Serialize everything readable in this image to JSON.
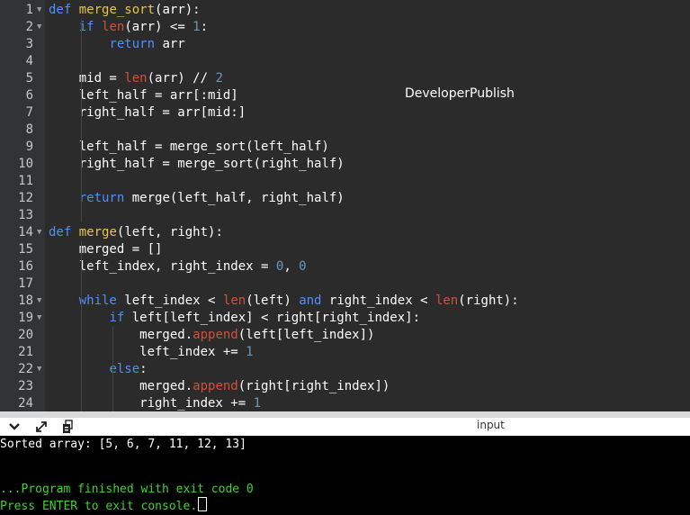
{
  "editor": {
    "watermark": "DeveloperPublish",
    "lines": [
      {
        "n": "1",
        "fold": true,
        "tokens": [
          [
            "def",
            "kw"
          ],
          [
            " "
          ],
          [
            "merge_sort",
            "fn"
          ],
          [
            "(arr):"
          ]
        ]
      },
      {
        "n": "2",
        "fold": true,
        "tokens": [
          [
            "    "
          ],
          [
            "if",
            "kw"
          ],
          [
            " "
          ],
          [
            "len",
            "bi"
          ],
          [
            "(arr) <= "
          ],
          [
            "1",
            "num"
          ],
          [
            ":"
          ]
        ]
      },
      {
        "n": "3",
        "tokens": [
          [
            "        "
          ],
          [
            "return",
            "kw"
          ],
          [
            " arr"
          ]
        ]
      },
      {
        "n": "4",
        "tokens": []
      },
      {
        "n": "5",
        "tokens": [
          [
            "    mid = "
          ],
          [
            "len",
            "bi"
          ],
          [
            "(arr) // "
          ],
          [
            "2",
            "num"
          ]
        ]
      },
      {
        "n": "6",
        "tokens": [
          [
            "    left_half = arr[:mid]"
          ]
        ]
      },
      {
        "n": "7",
        "tokens": [
          [
            "    right_half = arr[mid:]"
          ]
        ]
      },
      {
        "n": "8",
        "tokens": []
      },
      {
        "n": "9",
        "tokens": [
          [
            "    left_half = merge_sort(left_half)"
          ]
        ]
      },
      {
        "n": "10",
        "tokens": [
          [
            "    right_half = merge_sort(right_half)"
          ]
        ]
      },
      {
        "n": "11",
        "tokens": []
      },
      {
        "n": "12",
        "tokens": [
          [
            "    "
          ],
          [
            "return",
            "kw"
          ],
          [
            " merge(left_half, right_half)"
          ]
        ]
      },
      {
        "n": "13",
        "tokens": []
      },
      {
        "n": "14",
        "fold": true,
        "tokens": [
          [
            "def",
            "kw"
          ],
          [
            " "
          ],
          [
            "merge",
            "fn"
          ],
          [
            "(left, right):"
          ]
        ]
      },
      {
        "n": "15",
        "tokens": [
          [
            "    merged = []"
          ]
        ]
      },
      {
        "n": "16",
        "tokens": [
          [
            "    left_index, right_index = "
          ],
          [
            "0",
            "num"
          ],
          [
            ", "
          ],
          [
            "0",
            "num"
          ]
        ]
      },
      {
        "n": "17",
        "tokens": []
      },
      {
        "n": "18",
        "fold": true,
        "tokens": [
          [
            "    "
          ],
          [
            "while",
            "kw"
          ],
          [
            " left_index < "
          ],
          [
            "len",
            "bi"
          ],
          [
            "(left) "
          ],
          [
            "and",
            "kw"
          ],
          [
            " right_index < "
          ],
          [
            "len",
            "bi"
          ],
          [
            "(right):"
          ]
        ]
      },
      {
        "n": "19",
        "fold": true,
        "tokens": [
          [
            "        "
          ],
          [
            "if",
            "kw"
          ],
          [
            " left[left_index] < right[right_index]:"
          ]
        ]
      },
      {
        "n": "20",
        "tokens": [
          [
            "            merged."
          ],
          [
            "append",
            "bi"
          ],
          [
            "(left[left_index])"
          ]
        ]
      },
      {
        "n": "21",
        "tokens": [
          [
            "            left_index += "
          ],
          [
            "1",
            "num"
          ]
        ]
      },
      {
        "n": "22",
        "fold": true,
        "tokens": [
          [
            "        "
          ],
          [
            "else",
            "kw"
          ],
          [
            ":"
          ]
        ]
      },
      {
        "n": "23",
        "tokens": [
          [
            "            merged."
          ],
          [
            "append",
            "bi"
          ],
          [
            "(right[right_index])"
          ]
        ]
      },
      {
        "n": "24",
        "tokens": [
          [
            "            right_index += "
          ],
          [
            "1",
            "num"
          ]
        ]
      }
    ]
  },
  "toolbar": {
    "collapse_icon": "chevron-down-icon",
    "expand_icon": "expand-arrows-icon",
    "copy_icon": "copy-icon",
    "input_label": "input"
  },
  "console": {
    "output_line": "Sorted array: [5, 6, 7, 11, 12, 13]",
    "finished_line": "...Program finished with exit code 0",
    "prompt_line": "Press ENTER to exit console.",
    "colors": {
      "output": "#ffffff",
      "status": "#3dd62a"
    }
  }
}
